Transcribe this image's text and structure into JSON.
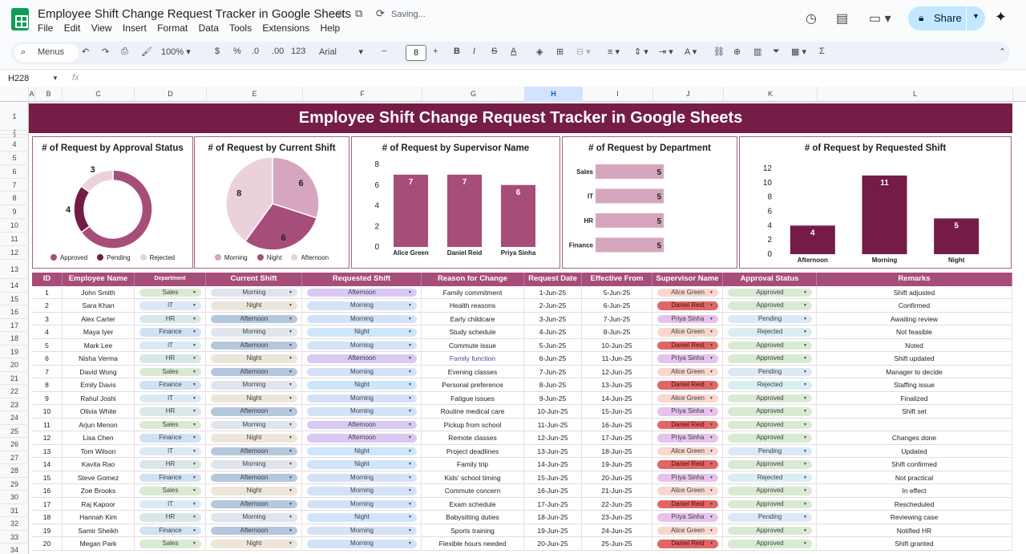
{
  "app": {
    "title": "Employee Shift Change Request Tracker in Google Sheets",
    "saving_status": "Saving...",
    "share_label": "Share",
    "menus": [
      "File",
      "Edit",
      "View",
      "Insert",
      "Format",
      "Data",
      "Tools",
      "Extensions",
      "Help"
    ]
  },
  "toolbar": {
    "search_label": "Menus",
    "zoom": "100%",
    "currency": "$",
    "percent": "%",
    "decrease_decimal": ".0",
    "increase_decimal": ".00",
    "number_format": "123",
    "font": "Arial",
    "font_size": "8"
  },
  "formula_bar": {
    "cell_ref": "H228",
    "fx": "fx"
  },
  "grid": {
    "columns": [
      {
        "label": "A"
      },
      {
        "label": "B"
      },
      {
        "label": "C"
      },
      {
        "label": "D"
      },
      {
        "label": "E"
      },
      {
        "label": "F"
      },
      {
        "label": "G"
      },
      {
        "label": "H",
        "selected": true
      },
      {
        "label": "I"
      },
      {
        "label": "J"
      },
      {
        "label": "K"
      },
      {
        "label": "L"
      }
    ],
    "rows": [
      "1",
      "2",
      "3",
      "4",
      "5",
      "6",
      "7",
      "8",
      "9",
      "10",
      "11",
      "12",
      "13",
      "14",
      "15",
      "16",
      "17",
      "18",
      "19",
      "20",
      "21",
      "22",
      "23",
      "24",
      "25",
      "26",
      "27",
      "28",
      "29",
      "30",
      "31",
      "32",
      "33",
      "34"
    ]
  },
  "banner": "Employee Shift Change Request Tracker in Google Sheets",
  "colors": {
    "banner": "#751d46",
    "header": "#a64d79",
    "approved": "#a64d79",
    "pending": "#741b47",
    "rejected": "#ead1dc",
    "bar_mid": "#a64d79",
    "bar_dark": "#741b47",
    "bar_light": "#d5a6bd"
  },
  "chart_data": [
    {
      "type": "pie",
      "title": "# of Request by Approval Status",
      "donut": true,
      "categories": [
        "Approved",
        "Pending",
        "Rejected"
      ],
      "values": [
        13,
        4,
        3
      ],
      "show_labels": [
        false,
        true,
        true
      ],
      "colors": [
        "#a64d79",
        "#741b47",
        "#ead1dc"
      ],
      "legend": "bottom"
    },
    {
      "type": "pie",
      "title": "# of Request by Current Shift",
      "donut": false,
      "categories": [
        "Morning",
        "Night",
        "Afternoon"
      ],
      "values": [
        6,
        6,
        8
      ],
      "colors": [
        "#d5a6bd",
        "#a64d79",
        "#ead1dc"
      ],
      "legend": "bottom"
    },
    {
      "type": "bar",
      "title": "# of Request by Supervisor Name",
      "categories": [
        "Alice Green",
        "Daniel Reid",
        "Priya Sinha"
      ],
      "values": [
        7,
        7,
        6
      ],
      "ylim": [
        0,
        8
      ],
      "yticks": [
        0,
        2,
        4,
        6,
        8
      ],
      "color": "#a64d79"
    },
    {
      "type": "bar",
      "orientation": "horizontal",
      "title": "# of Request  by Department",
      "categories": [
        "Sales",
        "IT",
        "HR",
        "Finance"
      ],
      "values": [
        5,
        5,
        5,
        5
      ],
      "xlim": [
        0,
        5
      ],
      "color": "#d5a6bd"
    },
    {
      "type": "bar",
      "title": "# of Request by Requested Shift",
      "categories": [
        "Afternoon",
        "Morning",
        "Night"
      ],
      "values": [
        4,
        11,
        5
      ],
      "ylim": [
        0,
        12
      ],
      "yticks": [
        0,
        2,
        4,
        6,
        8,
        10,
        12
      ],
      "color": "#741b47"
    }
  ],
  "table": {
    "headers": [
      "ID",
      "Employee Name",
      "Department",
      "Current Shift",
      "Requested Shift",
      "Reason for Change",
      "Request Date",
      "Effective From",
      "Supervisor Name",
      "Approval Status",
      "Remarks"
    ],
    "rows": [
      [
        "1",
        "John Smith",
        "Sales",
        "Morning",
        "Afternoon",
        "Family commitment",
        "1-Jun-25",
        "5-Jun-25",
        "Alice Green",
        "Approved",
        "Shift adjusted"
      ],
      [
        "2",
        "Sara Khan",
        "IT",
        "Night",
        "Morning",
        "Health reasons",
        "2-Jun-25",
        "6-Jun-25",
        "Daniel Reid",
        "Approved",
        "Confirmed"
      ],
      [
        "3",
        "Alex Carter",
        "HR",
        "Afternoon",
        "Morning",
        "Early childcare",
        "3-Jun-25",
        "7-Jun-25",
        "Priya Sinha",
        "Pending",
        "Awaiting review"
      ],
      [
        "4",
        "Maya Iyer",
        "Finance",
        "Morning",
        "Night",
        "Study schedule",
        "4-Jun-25",
        "8-Jun-25",
        "Alice Green",
        "Rejected",
        "Not feasible"
      ],
      [
        "5",
        "Mark Lee",
        "IT",
        "Afternoon",
        "Morning",
        "Commute issue",
        "5-Jun-25",
        "10-Jun-25",
        "Daniel Reid",
        "Approved",
        "Noted"
      ],
      [
        "6",
        "Nisha Verma",
        "HR",
        "Night",
        "Afternoon",
        "Family function",
        "6-Jun-25",
        "11-Jun-25",
        "Priya Sinha",
        "Approved",
        "Shift updated"
      ],
      [
        "7",
        "David Wong",
        "Sales",
        "Afternoon",
        "Morning",
        "Evening classes",
        "7-Jun-25",
        "12-Jun-25",
        "Alice Green",
        "Pending",
        "Manager to decide"
      ],
      [
        "8",
        "Emily Davis",
        "Finance",
        "Morning",
        "Night",
        "Personal preference",
        "8-Jun-25",
        "13-Jun-25",
        "Daniel Reid",
        "Rejected",
        "Staffing issue"
      ],
      [
        "9",
        "Rahul Joshi",
        "IT",
        "Night",
        "Morning",
        "Fatigue issues",
        "9-Jun-25",
        "14-Jun-25",
        "Alice Green",
        "Approved",
        "Finalized"
      ],
      [
        "10",
        "Olivia White",
        "HR",
        "Afternoon",
        "Morning",
        "Routine medical care",
        "10-Jun-25",
        "15-Jun-25",
        "Priya Sinha",
        "Approved",
        "Shift set"
      ],
      [
        "11",
        "Arjun Menon",
        "Sales",
        "Morning",
        "Afternoon",
        "Pickup from school",
        "11-Jun-25",
        "16-Jun-25",
        "Daniel Reid",
        "Approved",
        ""
      ],
      [
        "12",
        "Lisa Chen",
        "Finance",
        "Night",
        "Afternoon",
        "Remote classes",
        "12-Jun-25",
        "17-Jun-25",
        "Priya Sinha",
        "Approved",
        "Changes done"
      ],
      [
        "13",
        "Tom Wilson",
        "IT",
        "Afternoon",
        "Night",
        "Project deadlines",
        "13-Jun-25",
        "18-Jun-25",
        "Alice Green",
        "Pending",
        "Updated"
      ],
      [
        "14",
        "Kavita Rao",
        "HR",
        "Morning",
        "Night",
        "Family trip",
        "14-Jun-25",
        "19-Jun-25",
        "Daniel Reid",
        "Approved",
        "Shift confirmed"
      ],
      [
        "15",
        "Steve Gomez",
        "Finance",
        "Afternoon",
        "Morning",
        "Kids' school timing",
        "15-Jun-25",
        "20-Jun-25",
        "Priya Sinha",
        "Rejected",
        "Not practical"
      ],
      [
        "16",
        "Zoe Brooks",
        "Sales",
        "Night",
        "Morning",
        "Commute concern",
        "16-Jun-25",
        "21-Jun-25",
        "Alice Green",
        "Approved",
        "In effect"
      ],
      [
        "17",
        "Raj Kapoor",
        "IT",
        "Afternoon",
        "Morning",
        "Exam schedule",
        "17-Jun-25",
        "22-Jun-25",
        "Daniel Reid",
        "Approved",
        "Rescheduled"
      ],
      [
        "18",
        "Hannah Kim",
        "HR",
        "Morning",
        "Night",
        "Babysitting duties",
        "18-Jun-25",
        "23-Jun-25",
        "Priya Sinha",
        "Pending",
        "Reviewing case"
      ],
      [
        "19",
        "Samir Sheikh",
        "Finance",
        "Afternoon",
        "Morning",
        "Sports training",
        "19-Jun-25",
        "24-Jun-25",
        "Alice Green",
        "Approved",
        "Notified HR"
      ],
      [
        "20",
        "Megan Park",
        "Sales",
        "Night",
        "Morning",
        "Flexible hours needed",
        "20-Jun-25",
        "25-Jun-25",
        "Daniel Reid",
        "Approved",
        "Shift granted"
      ]
    ]
  }
}
